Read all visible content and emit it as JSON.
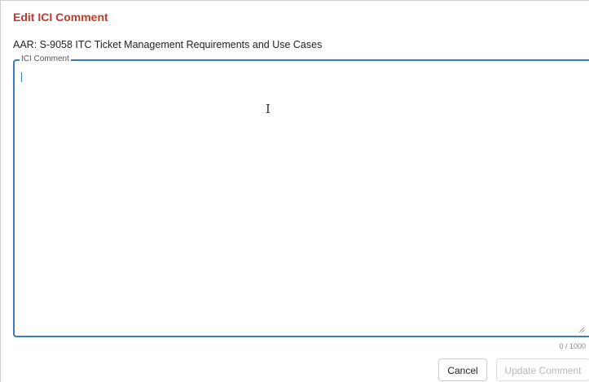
{
  "dialog": {
    "title": "Edit ICI Comment",
    "subtitle": "AAR: S-9058 ITC Ticket Management Requirements and Use Cases"
  },
  "comment_field": {
    "legend": "ICI Comment",
    "value": "",
    "counter": "0 / 1000"
  },
  "buttons": {
    "cancel": "Cancel",
    "update": "Update Comment"
  },
  "colors": {
    "title": "#c0392b",
    "field_border": "#3b7bbf",
    "disabled_text": "#b8b8b8"
  }
}
